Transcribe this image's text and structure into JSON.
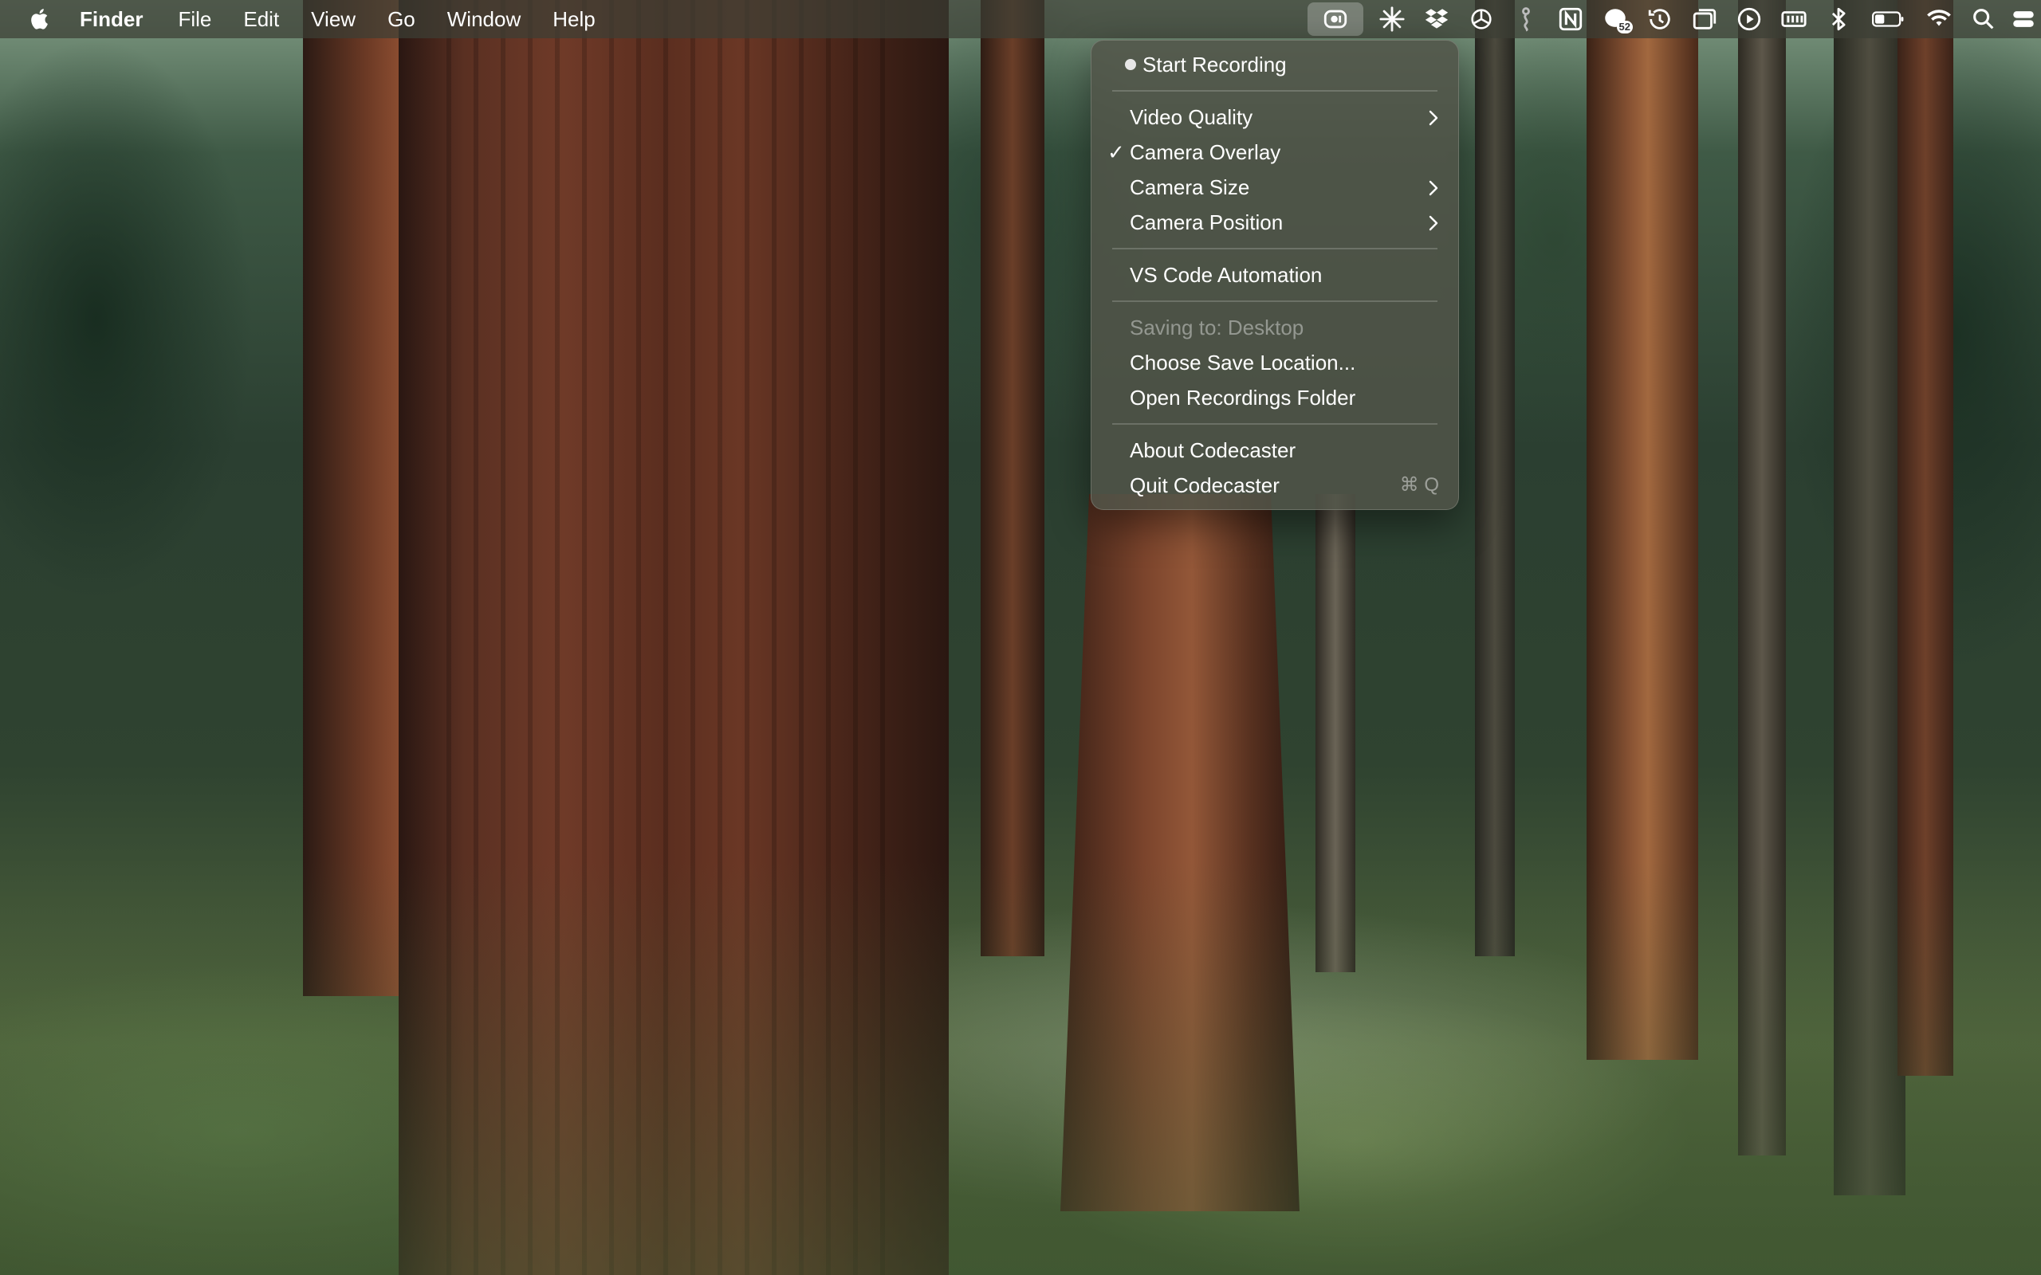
{
  "menubar": {
    "app_name": "Finder",
    "menus": [
      "File",
      "Edit",
      "View",
      "Go",
      "Window",
      "Help"
    ],
    "status_icons": [
      {
        "name": "codecaster-record-icon",
        "active": true
      },
      {
        "name": "sparkle-icon"
      },
      {
        "name": "dropbox-icon"
      },
      {
        "name": "openai-icon"
      },
      {
        "name": "figure-icon"
      },
      {
        "name": "notion-icon"
      },
      {
        "name": "messages-badge-icon",
        "badge": "52"
      },
      {
        "name": "time-machine-icon"
      },
      {
        "name": "window-switcher-icon"
      },
      {
        "name": "play-icon"
      },
      {
        "name": "memory-icon"
      },
      {
        "name": "bluetooth-icon"
      },
      {
        "name": "battery-icon"
      },
      {
        "name": "wifi-icon"
      },
      {
        "name": "spotlight-search-icon"
      },
      {
        "name": "control-center-icon"
      }
    ]
  },
  "dropdown": {
    "start_recording": "Start Recording",
    "video_quality": "Video Quality",
    "camera_overlay": "Camera Overlay",
    "camera_overlay_checked": true,
    "camera_size": "Camera Size",
    "camera_position": "Camera Position",
    "vscode_automation": "VS Code Automation",
    "saving_to": "Saving to: Desktop",
    "choose_save_location": "Choose Save Location...",
    "open_recordings_folder": "Open Recordings Folder",
    "about": "About Codecaster",
    "quit": "Quit Codecaster",
    "quit_shortcut": "⌘ Q",
    "check_glyph": "✓"
  }
}
